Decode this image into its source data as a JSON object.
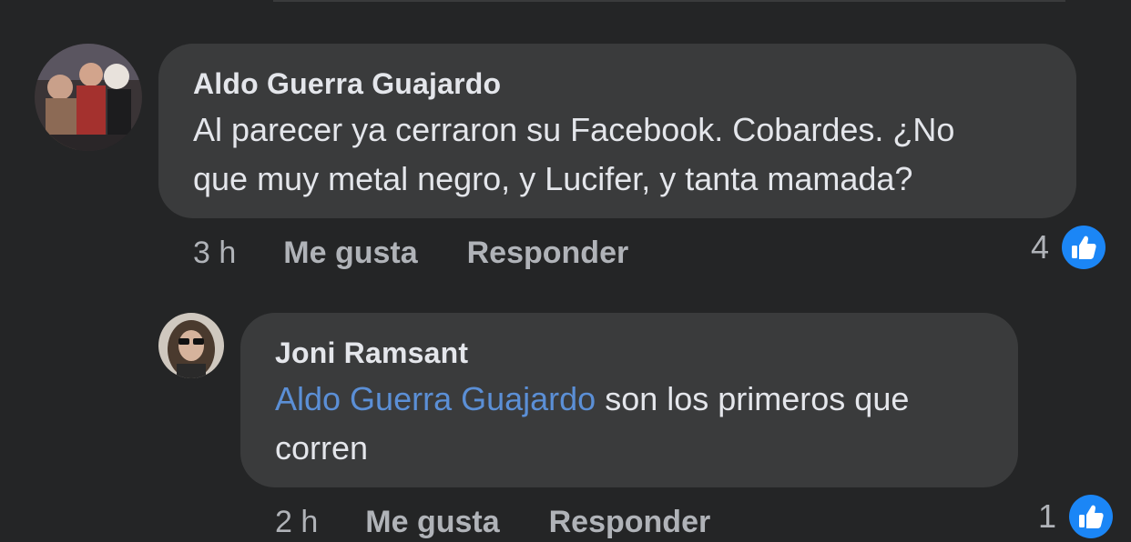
{
  "comments": [
    {
      "author": "Aldo Guerra Guajardo",
      "text_line1": "Al parecer ya cerraron su Facebook. Cobardes. ¿No",
      "text_line2": "que muy metal negro, y Lucifer, y tanta mamada?",
      "time": "3 h",
      "like_label": "Me gusta",
      "reply_label": "Responder",
      "reaction_count": "4",
      "reaction_icon": "like-icon"
    },
    {
      "author": "Joni Ramsant",
      "mention": "Aldo Guerra Guajardo",
      "text_rest": " son los primeros que",
      "text_line2": "corren",
      "time": "2 h",
      "like_label": "Me gusta",
      "reply_label": "Responder",
      "reaction_count": "1",
      "reaction_icon": "like-icon"
    }
  ],
  "colors": {
    "background": "#242526",
    "bubble": "#3a3b3c",
    "text": "#e4e6eb",
    "secondary": "#b0b3b8",
    "mention": "#5b8fd6",
    "like_blue": "#1b86f6"
  }
}
